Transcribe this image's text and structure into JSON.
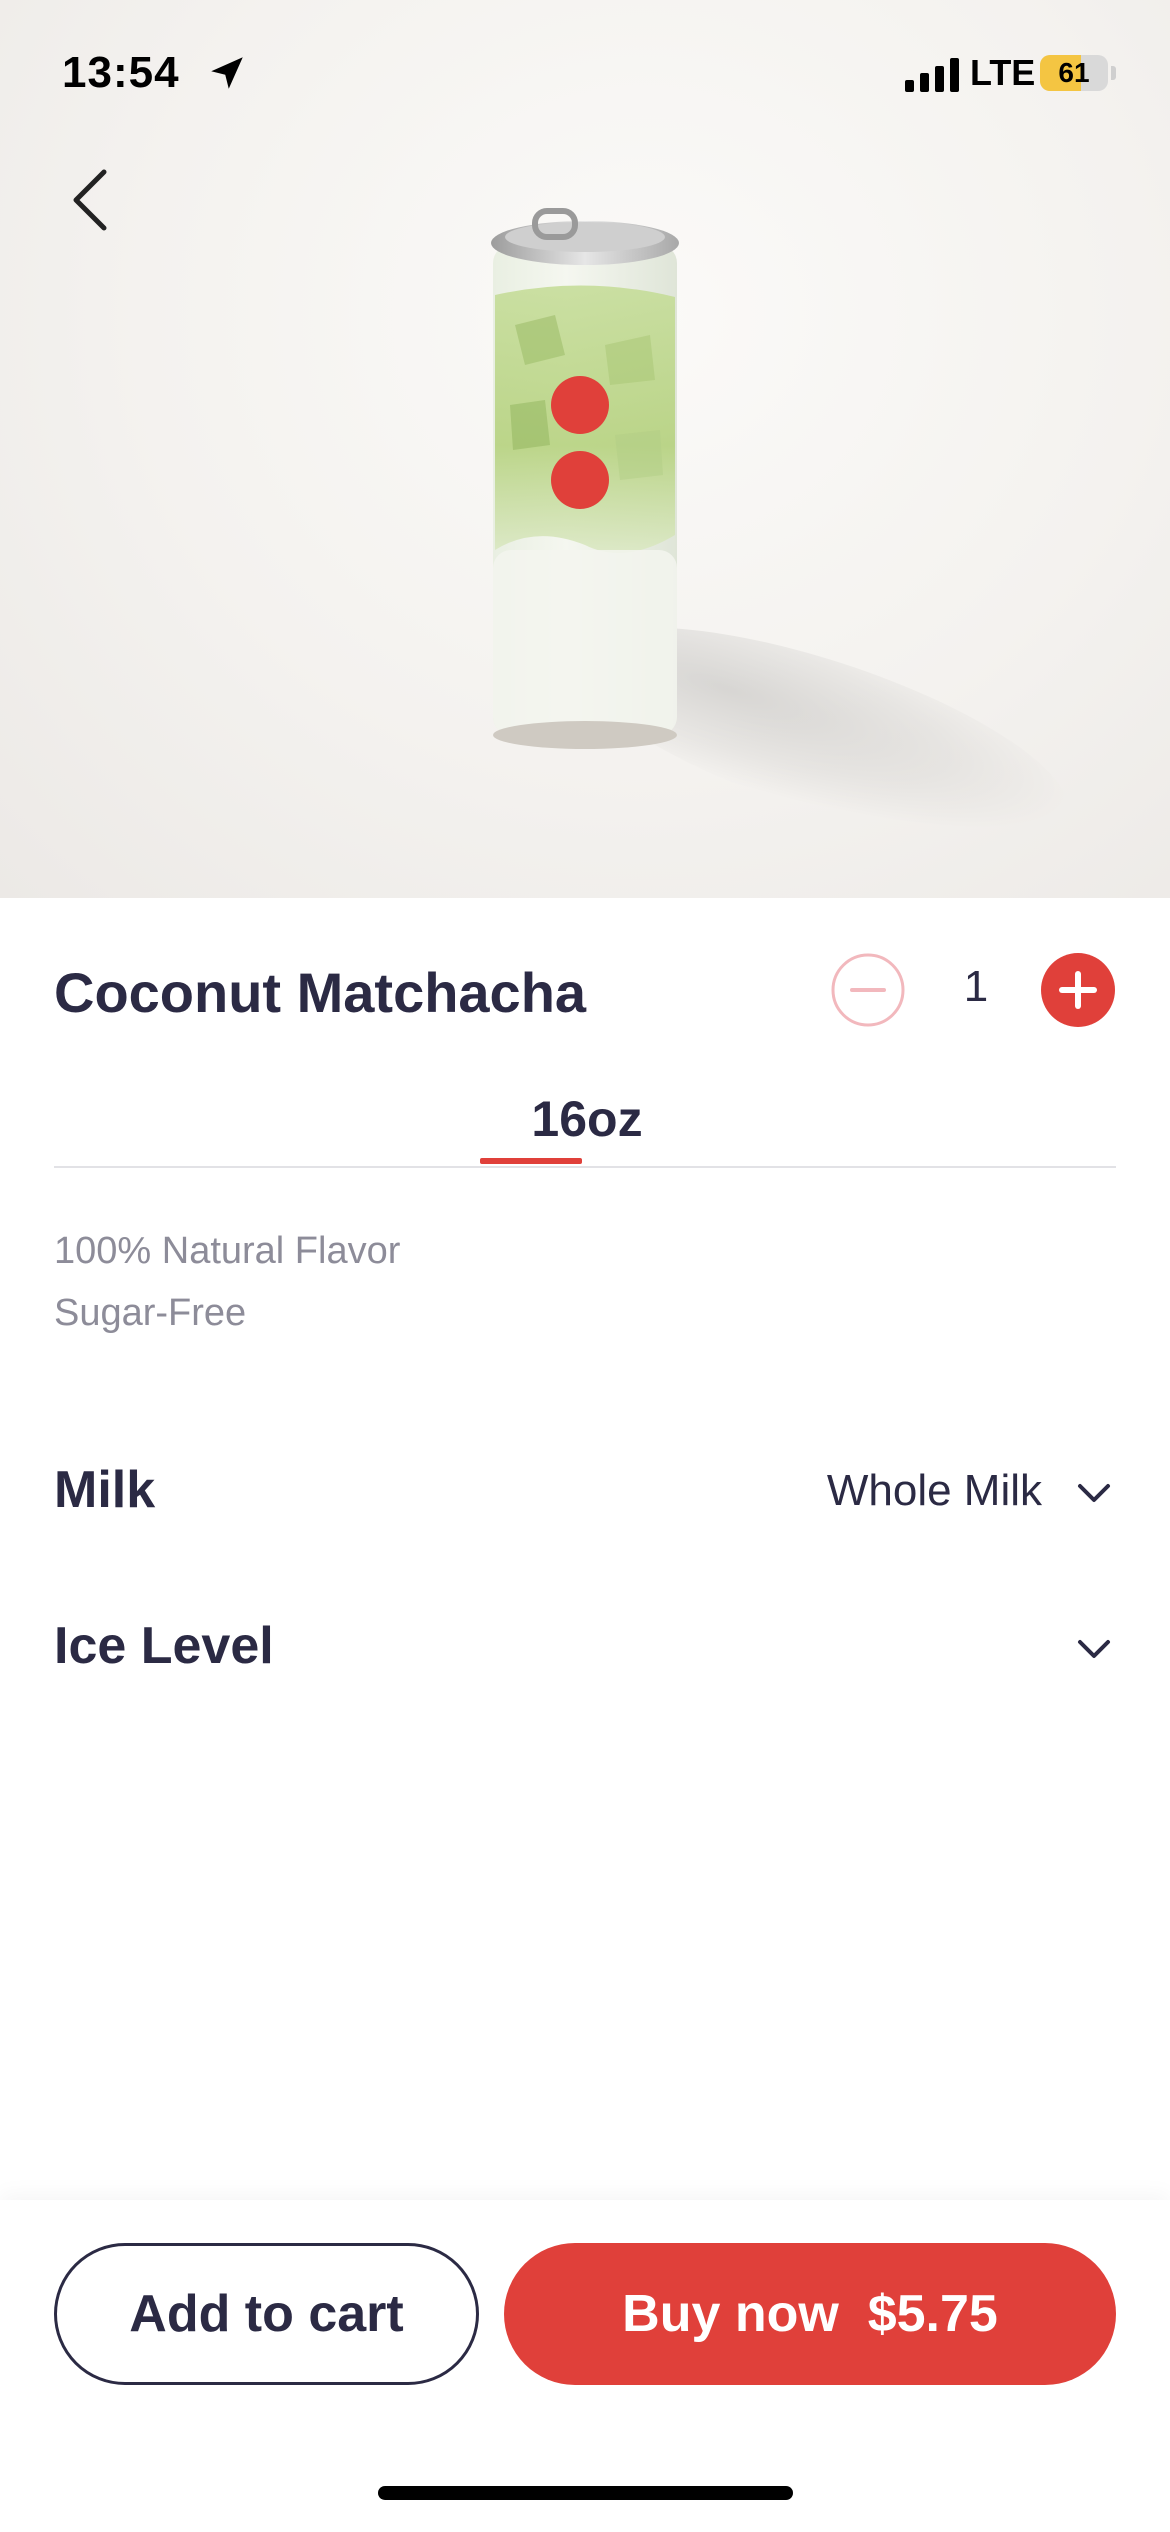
{
  "status_bar": {
    "time": "13:54",
    "network": "LTE",
    "battery_level": "61",
    "battery_fraction": 0.61,
    "battery_color": "#f4c542"
  },
  "product": {
    "name": "Coconut Matchacha",
    "quantity": "1",
    "sizes": [
      "16oz"
    ],
    "selected_size": "16oz",
    "description": [
      "100% Natural Flavor",
      "Sugar-Free"
    ]
  },
  "options": [
    {
      "label": "Milk",
      "value": "Whole Milk"
    },
    {
      "label": "Ice Level",
      "value": ""
    }
  ],
  "actions": {
    "add_to_cart": "Add to cart",
    "buy_now": "Buy now",
    "price": "$5.75"
  },
  "colors": {
    "accent": "#e0403a",
    "text": "#2b2a44",
    "muted": "#8d8c99"
  },
  "icons": [
    "location-arrow-icon",
    "signal-icon",
    "battery-icon",
    "back-chevron-icon",
    "minus-circle-icon",
    "plus-circle-icon",
    "chevron-down-icon"
  ]
}
